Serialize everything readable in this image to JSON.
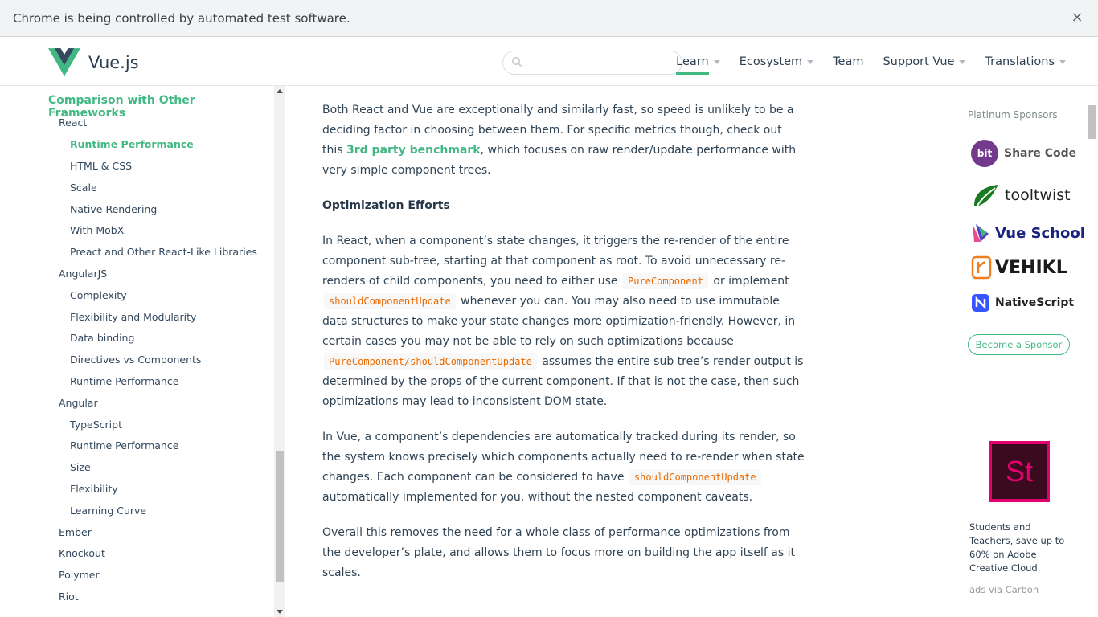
{
  "infobar": {
    "text": "Chrome is being controlled by automated test software.",
    "close": "×"
  },
  "header": {
    "logo_text": "Vue.js",
    "search_placeholder": "",
    "nav": [
      {
        "label": "Learn",
        "active": true,
        "dropdown": true
      },
      {
        "label": "Ecosystem",
        "dropdown": true
      },
      {
        "label": "Team",
        "dropdown": false
      },
      {
        "label": "Support Vue",
        "dropdown": true
      },
      {
        "label": "Translations",
        "dropdown": true
      }
    ]
  },
  "sidebar": {
    "title": "Comparison with Other Frameworks",
    "items": [
      {
        "label": "React",
        "level": 1
      },
      {
        "label": "Runtime Performance",
        "level": 2,
        "active": true
      },
      {
        "label": "HTML & CSS",
        "level": 2
      },
      {
        "label": "Scale",
        "level": 2
      },
      {
        "label": "Native Rendering",
        "level": 2
      },
      {
        "label": "With MobX",
        "level": 2
      },
      {
        "label": "Preact and Other React-Like Libraries",
        "level": 2
      },
      {
        "label": "AngularJS",
        "level": 1
      },
      {
        "label": "Complexity",
        "level": 2
      },
      {
        "label": "Flexibility and Modularity",
        "level": 2
      },
      {
        "label": "Data binding",
        "level": 2
      },
      {
        "label": "Directives vs Components",
        "level": 2
      },
      {
        "label": "Runtime Performance",
        "level": 2
      },
      {
        "label": "Angular",
        "level": 1
      },
      {
        "label": "TypeScript",
        "level": 2
      },
      {
        "label": "Runtime Performance",
        "level": 2
      },
      {
        "label": "Size",
        "level": 2
      },
      {
        "label": "Flexibility",
        "level": 2
      },
      {
        "label": "Learning Curve",
        "level": 2
      },
      {
        "label": "Ember",
        "level": 1
      },
      {
        "label": "Knockout",
        "level": 1
      },
      {
        "label": "Polymer",
        "level": 1
      },
      {
        "label": "Riot",
        "level": 1
      }
    ]
  },
  "content": {
    "p1_a": "Both React and Vue are exceptionally and similarly fast, so speed is unlikely to be a deciding factor in choosing between them. For specific metrics though, check out this ",
    "p1_link": "3rd party benchmark",
    "p1_b": ", which focuses on raw render/update performance with very simple component trees.",
    "h_opt": "Optimization Efforts",
    "p2_a": "In React, when a component’s state changes, it triggers the re-render of the entire component sub-tree, starting at that component as root. To avoid unnecessary re-renders of child components, you need to either use ",
    "p2_code1": "PureComponent",
    "p2_b": " or implement ",
    "p2_code2": "shouldComponentUpdate",
    "p2_c": " whenever you can. You may also need to use immutable data structures to make your state changes more optimization-friendly. However, in certain cases you may not be able to rely on such optimizations because ",
    "p2_code3": "PureComponent/shouldComponentUpdate",
    "p2_d": " assumes the entire sub tree’s render output is determined by the props of the current component. If that is not the case, then such optimizations may lead to inconsistent DOM state.",
    "p3_a": "In Vue, a component’s dependencies are automatically tracked during its render, so the system knows precisely which components actually need to re-render when state changes. Each component can be considered to have ",
    "p3_code": "shouldComponentUpdate",
    "p3_b": " automatically implemented for you, without the nested component caveats.",
    "p4": "Overall this removes the need for a whole class of performance optimizations from the developer’s plate, and allows them to focus more on building the app itself as it scales."
  },
  "sponsors": {
    "title": "Platinum Sponsors",
    "items": [
      "Share Code",
      "tooltwist",
      "Vue School",
      "VEHIKL",
      "NativeScript"
    ],
    "bit_badge": "bit",
    "become": "Become a Sponsor"
  },
  "ad": {
    "logo_text": "St",
    "text": "Students and Teachers, save up to 60% on Adobe Creative Cloud.",
    "via": "ads via Carbon"
  },
  "colors": {
    "accent": "#42b983",
    "code": "#e96900",
    "text": "#304455"
  }
}
